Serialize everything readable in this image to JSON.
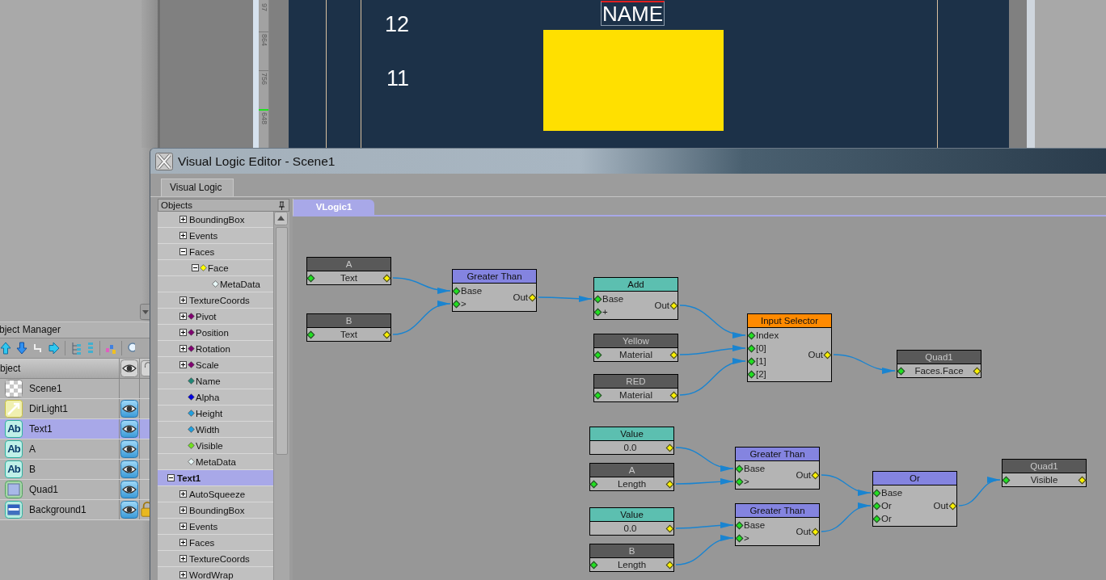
{
  "viewport": {
    "ruler_labels": [
      "97",
      "864",
      "756",
      "648"
    ],
    "row_numbers": [
      "12",
      "11"
    ],
    "text_object": "NAME"
  },
  "object_manager": {
    "title": "bject Manager",
    "column_header": "bject",
    "rows": [
      {
        "label": "Scene1",
        "kind": "scene",
        "visible": false,
        "locked": false,
        "selected": false
      },
      {
        "label": "DirLight1",
        "kind": "light",
        "visible": true,
        "locked": false,
        "selected": false
      },
      {
        "label": "Text1",
        "kind": "text",
        "icon_text": "Ab",
        "visible": true,
        "locked": false,
        "selected": true
      },
      {
        "label": "A",
        "kind": "text",
        "icon_text": "Ab",
        "visible": true,
        "locked": false,
        "selected": false
      },
      {
        "label": "B",
        "kind": "text",
        "icon_text": "Ab",
        "visible": true,
        "locked": false,
        "selected": false
      },
      {
        "label": "Quad1",
        "kind": "quad",
        "visible": true,
        "locked": false,
        "selected": false
      },
      {
        "label": "Background1",
        "kind": "background",
        "visible": true,
        "locked": true,
        "selected": false
      }
    ]
  },
  "editor": {
    "title": "Visual Logic Editor - Scene1",
    "tabs": [
      {
        "label": "Visual Logic",
        "selected": true
      }
    ],
    "objects_panel": {
      "title": "Objects",
      "tree": [
        {
          "children": [
            {
              "label": "BoundingBox",
              "expanded": false,
              "selected": false
            },
            {
              "label": "Events",
              "expanded": false,
              "selected": false
            },
            {
              "label": "Faces",
              "expanded": true,
              "selected": false,
              "children": [
                {
                  "label": "Face",
                  "expanded": true,
                  "color": "#ffff00",
                  "selected": false,
                  "children": [
                    {
                      "label": "MetaData",
                      "color": "#e8f8f8",
                      "selected": false
                    }
                  ]
                }
              ]
            },
            {
              "label": "TextureCoords",
              "expanded": false,
              "selected": false
            },
            {
              "label": "Pivot",
              "expanded": false,
              "color": "#800070",
              "selected": false
            },
            {
              "label": "Position",
              "expanded": false,
              "color": "#800070",
              "selected": false
            },
            {
              "label": "Rotation",
              "expanded": false,
              "color": "#800070",
              "selected": false
            },
            {
              "label": "Scale",
              "expanded": false,
              "color": "#800070",
              "selected": false
            },
            {
              "label": "Name",
              "color": "#208878",
              "selected": false
            },
            {
              "label": "Alpha",
              "color": "#0000e0",
              "selected": false
            },
            {
              "label": "Height",
              "color": "#20a0e0",
              "selected": false
            },
            {
              "label": "Width",
              "color": "#20a0e0",
              "selected": false
            },
            {
              "label": "Visible",
              "color": "#70e020",
              "selected": false
            },
            {
              "label": "MetaData",
              "color": "#e8f8f8",
              "selected": false
            }
          ]
        },
        {
          "label": "Text1",
          "expanded": true,
          "selected": true,
          "children": [
            {
              "label": "AutoSqueeze",
              "expanded": false,
              "selected": false
            },
            {
              "label": "BoundingBox",
              "expanded": false,
              "selected": false
            },
            {
              "label": "Events",
              "expanded": false,
              "selected": false
            },
            {
              "label": "Faces",
              "expanded": false,
              "selected": false
            },
            {
              "label": "TextureCoords",
              "expanded": false,
              "selected": false
            },
            {
              "label": "WordWrap",
              "expanded": false,
              "selected": false
            }
          ]
        }
      ]
    },
    "graph_tabs": [
      {
        "label": "VLogic1",
        "selected": true
      }
    ],
    "nodes": [
      {
        "kind": "object",
        "title": "A",
        "field": "Text"
      },
      {
        "kind": "object",
        "title": "B",
        "field": "Text"
      },
      {
        "kind": "compare",
        "title": "Greater Than",
        "inputs": [
          "Base",
          ">"
        ],
        "output": "Out"
      },
      {
        "kind": "math",
        "title": "Add",
        "inputs": [
          "Base",
          "+"
        ],
        "output": "Out"
      },
      {
        "kind": "object",
        "title": "Yellow",
        "field": "Material"
      },
      {
        "kind": "object",
        "title": "RED",
        "field": "Material"
      },
      {
        "kind": "selector",
        "title": "Input Selector",
        "inputs": [
          "Index",
          "[0]",
          "[1]",
          "[2]"
        ],
        "output": "Out"
      },
      {
        "kind": "object",
        "title": "Quad1",
        "field": "Faces.Face"
      },
      {
        "kind": "value",
        "title": "Value",
        "field": "0.0"
      },
      {
        "kind": "object",
        "title": "A",
        "field": "Length"
      },
      {
        "kind": "compare",
        "title": "Greater Than",
        "inputs": [
          "Base",
          ">"
        ],
        "output": "Out"
      },
      {
        "kind": "value",
        "title": "Value",
        "field": "0.0"
      },
      {
        "kind": "object",
        "title": "B",
        "field": "Length"
      },
      {
        "kind": "compare",
        "title": "Greater Than",
        "inputs": [
          "Base",
          ">"
        ],
        "output": "Out"
      },
      {
        "kind": "logic",
        "title": "Or",
        "inputs": [
          "Base",
          "Or",
          "Or"
        ],
        "output": "Out"
      },
      {
        "kind": "object",
        "title": "Quad1",
        "field": "Visible"
      }
    ]
  }
}
